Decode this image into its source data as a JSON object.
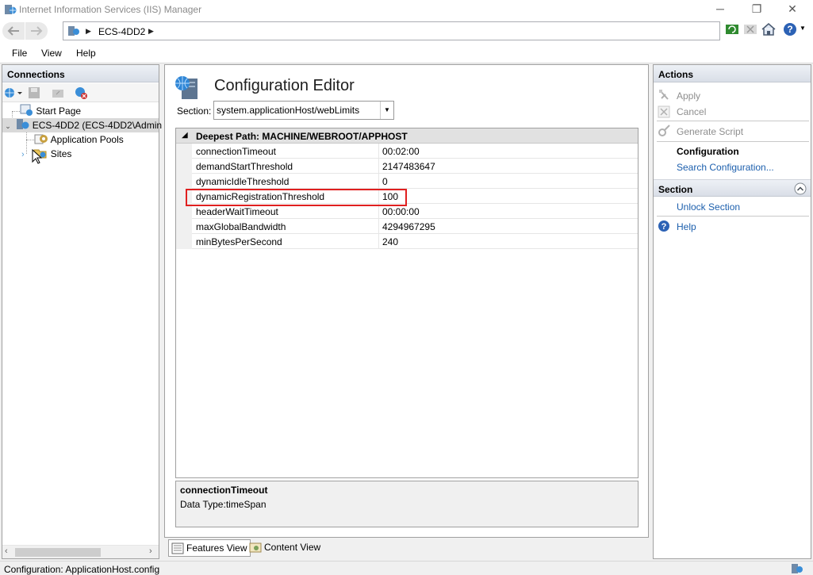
{
  "window": {
    "title": "Internet Information Services (IIS) Manager",
    "minimize": "─",
    "restore": "❐",
    "close": "✕"
  },
  "address": {
    "crumbs": [
      "ECS-4DD2"
    ],
    "sep": "▶"
  },
  "menu": [
    "File",
    "View",
    "Help"
  ],
  "connections": {
    "header": "Connections",
    "tree": [
      {
        "label": "Start Page",
        "level": 1
      },
      {
        "label": "ECS-4DD2 (ECS-4DD2\\Admin",
        "level": 0,
        "expanded": true,
        "selected": true
      },
      {
        "label": "Application Pools",
        "level": 2
      },
      {
        "label": "Sites",
        "level": 2,
        "expandable": true
      }
    ]
  },
  "editor": {
    "title": "Configuration Editor",
    "section_label": "Section:",
    "section_value": "system.applicationHost/webLimits",
    "path_header": "Deepest Path: MACHINE/WEBROOT/APPHOST",
    "rows": [
      {
        "key": "connectionTimeout",
        "value": "00:02:00"
      },
      {
        "key": "demandStartThreshold",
        "value": "2147483647"
      },
      {
        "key": "dynamicIdleThreshold",
        "value": "0"
      },
      {
        "key": "dynamicRegistrationThreshold",
        "value": "100"
      },
      {
        "key": "headerWaitTimeout",
        "value": "00:00:00"
      },
      {
        "key": "maxGlobalBandwidth",
        "value": "4294967295"
      },
      {
        "key": "minBytesPerSecond",
        "value": "240"
      }
    ],
    "highlighted_key": "dynamicRegistrationThreshold",
    "description": {
      "name": "connectionTimeout",
      "data_type": "Data Type:timeSpan"
    }
  },
  "view_tabs": {
    "features": "Features View",
    "content": "Content View"
  },
  "actions": {
    "header": "Actions",
    "apply": "Apply",
    "cancel": "Cancel",
    "generate_script": "Generate Script",
    "configuration_heading": "Configuration",
    "search_configuration": "Search Configuration...",
    "section_header": "Section",
    "unlock_section": "Unlock Section",
    "help": "Help"
  },
  "status": {
    "text": "Configuration: ApplicationHost.config"
  },
  "colors": {
    "accent_link": "#1c5fad",
    "highlight_box": "#e02020"
  }
}
